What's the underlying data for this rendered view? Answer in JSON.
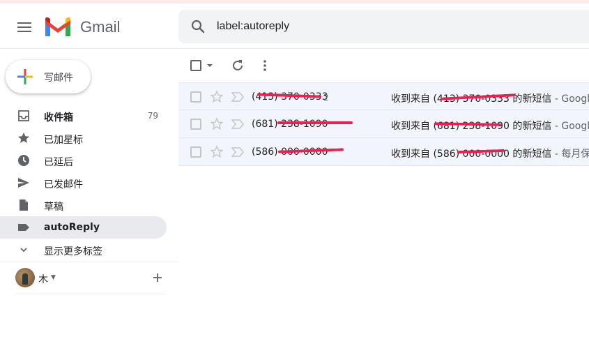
{
  "app": {
    "name": "Gmail"
  },
  "header": {
    "search_value": "label:autoreply"
  },
  "compose": {
    "label": "写邮件"
  },
  "sidebar": {
    "items": [
      {
        "label": "收件箱",
        "count": "79",
        "icon": "inbox-icon"
      },
      {
        "label": "已加星标",
        "count": "",
        "icon": "star-icon"
      },
      {
        "label": "已延后",
        "count": "",
        "icon": "clock-icon"
      },
      {
        "label": "已发邮件",
        "count": "",
        "icon": "send-icon"
      },
      {
        "label": "草稿",
        "count": "",
        "icon": "draft-icon"
      },
      {
        "label": "autoReply",
        "count": "",
        "icon": "label-icon"
      },
      {
        "label": "显示更多标签",
        "count": "",
        "icon": "chevron-down-icon"
      }
    ]
  },
  "hangouts": {
    "user": "木"
  },
  "emails": [
    {
      "sender": "(413) 370-0333",
      "thread_count": "2",
      "subject": "收到来自 (413) 370-0333 的新短信",
      "snippet": " - Google Voice"
    },
    {
      "sender": "(681) 238-1090",
      "thread_count": "",
      "subject": "收到来自 (681) 238-1090 的新短信",
      "snippet": " - Google Voice"
    },
    {
      "sender": "(586) 000-0000",
      "thread_count": "",
      "subject": "收到来自 (586) 000-0000 的新短信",
      "snippet": " - 每月保号"
    }
  ],
  "colors": {
    "active_bg": "#e8eaed",
    "row_bg": "#f2f6fc",
    "redaction": "#f01d52"
  }
}
